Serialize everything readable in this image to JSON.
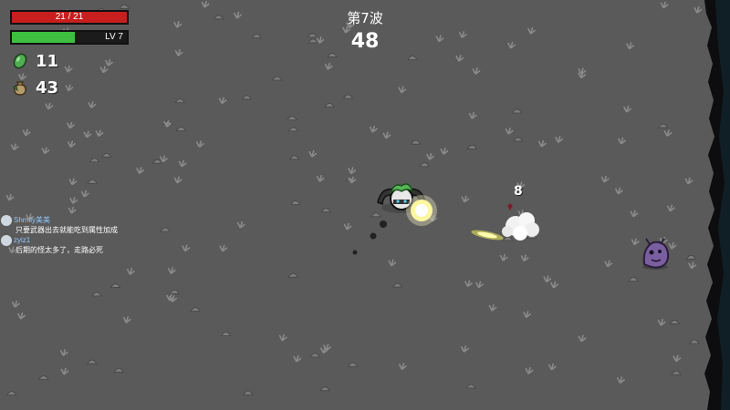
{
  "hud": {
    "hp_text": "21 / 21",
    "hp_fraction": 1.0,
    "level_text": "LV 7",
    "xp_fraction": 0.55,
    "materials_count": "11",
    "bag_count": "43"
  },
  "wave": {
    "title": "第7波",
    "timer": "48"
  },
  "combat": {
    "damage_number": "8"
  },
  "chat": [
    {
      "name": "Shmily美美",
      "message": "只要武器出去就能吃到属性加成"
    },
    {
      "name": "zyiz1",
      "message": "后期的怪太多了，走路必死"
    }
  ],
  "colors": {
    "ground": "#5a5a5a",
    "hp": "#c81e1e",
    "xp": "#3fbf3f",
    "enemy": "#7a5fa0"
  },
  "icons": {
    "materials": "green-material-icon",
    "bag": "loot-bag-icon"
  }
}
